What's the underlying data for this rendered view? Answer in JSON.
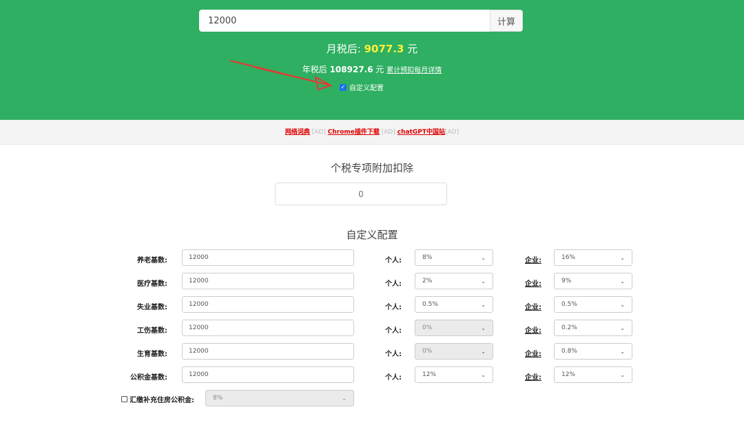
{
  "header": {
    "salary_value": "12000",
    "calc_label": "计算",
    "monthly_prefix": "月税后:",
    "monthly_value": "9077.3",
    "monthly_unit": "元",
    "yearly_prefix": "年税后",
    "yearly_value": "108927.6",
    "yearly_unit": "元",
    "yearly_link": "累计预扣每月详情",
    "custom_label": "自定义配置",
    "custom_checked": true
  },
  "adbar": {
    "items": [
      {
        "label": "网络词典",
        "tag": "[AD]"
      },
      {
        "label": "Chrome插件下载",
        "tag": "[AD]"
      },
      {
        "label": "chatGPT中国站",
        "tag": "[AD]"
      }
    ]
  },
  "deduction": {
    "title": "个税专项附加扣除",
    "placeholder": "0"
  },
  "config": {
    "title": "自定义配置",
    "personal_label": "个人:",
    "company_label": "企业:",
    "rows": [
      {
        "label": "养老基数:",
        "base": "12000",
        "personal": "8%",
        "company": "16%",
        "personal_disabled": false
      },
      {
        "label": "医疗基数:",
        "base": "12000",
        "personal": "2%",
        "company": "9%",
        "personal_disabled": false
      },
      {
        "label": "失业基数:",
        "base": "12000",
        "personal": "0.5%",
        "company": "0.5%",
        "personal_disabled": false
      },
      {
        "label": "工伤基数:",
        "base": "12000",
        "personal": "0%",
        "company": "0.2%",
        "personal_disabled": true
      },
      {
        "label": "生育基数:",
        "base": "12000",
        "personal": "0%",
        "company": "0.8%",
        "personal_disabled": true
      },
      {
        "label": "公积金基数:",
        "base": "12000",
        "personal": "12%",
        "company": "12%",
        "personal_disabled": false
      }
    ],
    "supplement_label": "汇缴补充住房公积金:",
    "supplement_value": "8%",
    "supplement_checked": false
  },
  "colors": {
    "header_bg": "#2eaf61",
    "highlight": "#ffef3a",
    "ad_link": "#e00000",
    "arrow": "#e53935"
  }
}
